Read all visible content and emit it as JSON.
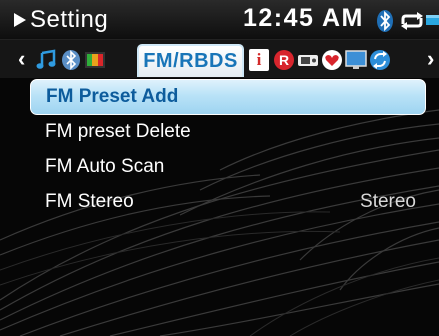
{
  "status_bar": {
    "title": "Setting",
    "time": "12:45 AM",
    "icons": [
      "play-icon",
      "bluetooth-icon",
      "repeat-icon",
      "battery-icon"
    ]
  },
  "tab_strip": {
    "active_tab": "FM/RBDS",
    "left_icons": [
      "music-note-icon",
      "bluetooth-icon",
      "display-icon"
    ],
    "right_icons": [
      "info-icon",
      "record-icon",
      "device-icon",
      "heart-icon",
      "monitor-icon",
      "sync-icon"
    ]
  },
  "menu": {
    "items": [
      {
        "label": "FM Preset Add",
        "value": "",
        "selected": true
      },
      {
        "label": "FM preset Delete",
        "value": "",
        "selected": false
      },
      {
        "label": "FM Auto Scan",
        "value": "",
        "selected": false
      },
      {
        "label": "FM Stereo",
        "value": "Stereo",
        "selected": false
      }
    ]
  },
  "colors": {
    "accent": "#1875b8",
    "selected_bg": "#b9e2f7",
    "background": "#060606"
  }
}
